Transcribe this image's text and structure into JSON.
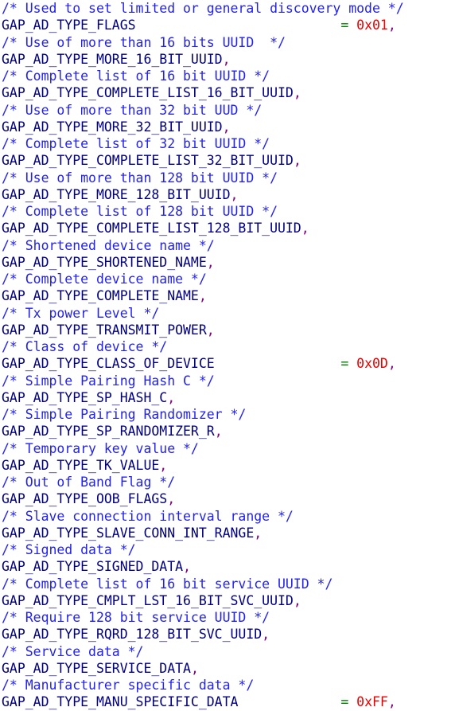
{
  "editor": {
    "background_color": "#ffffff",
    "font_size_px": 16.5,
    "line_height_px": 21.25,
    "language": "c",
    "total_lines": 38
  },
  "syntax_colors": {
    "comment": "#2222ee",
    "identifier": "#000080",
    "operator": "#008000",
    "number": "#ee0000",
    "punctuation": "#800080",
    "plain": "#000000"
  },
  "code": {
    "lines": [
      {
        "tokens": [
          {
            "t": "comment",
            "s": "/* Used to set limited or general discovery mode */"
          }
        ]
      },
      {
        "tokens": [
          {
            "t": "identifier",
            "s": "GAP_AD_TYPE_FLAGS"
          },
          {
            "t": "plain",
            "s": "                          "
          },
          {
            "t": "operator",
            "s": "="
          },
          {
            "t": "plain",
            "s": " "
          },
          {
            "t": "number",
            "s": "0x01"
          },
          {
            "t": "punct",
            "s": ","
          }
        ]
      },
      {
        "tokens": [
          {
            "t": "comment",
            "s": "/* Use of more than 16 bits UUID  */"
          }
        ]
      },
      {
        "tokens": [
          {
            "t": "identifier",
            "s": "GAP_AD_TYPE_MORE_16_BIT_UUID"
          },
          {
            "t": "punct",
            "s": ","
          }
        ]
      },
      {
        "tokens": [
          {
            "t": "comment",
            "s": "/* Complete list of 16 bit UUID */"
          }
        ]
      },
      {
        "tokens": [
          {
            "t": "identifier",
            "s": "GAP_AD_TYPE_COMPLETE_LIST_16_BIT_UUID"
          },
          {
            "t": "punct",
            "s": ","
          }
        ]
      },
      {
        "tokens": [
          {
            "t": "comment",
            "s": "/* Use of more than 32 bit UUD */"
          }
        ]
      },
      {
        "tokens": [
          {
            "t": "identifier",
            "s": "GAP_AD_TYPE_MORE_32_BIT_UUID"
          },
          {
            "t": "punct",
            "s": ","
          }
        ]
      },
      {
        "tokens": [
          {
            "t": "comment",
            "s": "/* Complete list of 32 bit UUID */"
          }
        ]
      },
      {
        "tokens": [
          {
            "t": "identifier",
            "s": "GAP_AD_TYPE_COMPLETE_LIST_32_BIT_UUID"
          },
          {
            "t": "punct",
            "s": ","
          }
        ]
      },
      {
        "tokens": [
          {
            "t": "comment",
            "s": "/* Use of more than 128 bit UUID */"
          }
        ]
      },
      {
        "tokens": [
          {
            "t": "identifier",
            "s": "GAP_AD_TYPE_MORE_128_BIT_UUID"
          },
          {
            "t": "punct",
            "s": ","
          }
        ]
      },
      {
        "tokens": [
          {
            "t": "comment",
            "s": "/* Complete list of 128 bit UUID */"
          }
        ]
      },
      {
        "tokens": [
          {
            "t": "identifier",
            "s": "GAP_AD_TYPE_COMPLETE_LIST_128_BIT_UUID"
          },
          {
            "t": "punct",
            "s": ","
          }
        ]
      },
      {
        "tokens": [
          {
            "t": "comment",
            "s": "/* Shortened device name */"
          }
        ]
      },
      {
        "tokens": [
          {
            "t": "identifier",
            "s": "GAP_AD_TYPE_SHORTENED_NAME"
          },
          {
            "t": "punct",
            "s": ","
          }
        ]
      },
      {
        "tokens": [
          {
            "t": "comment",
            "s": "/* Complete device name */"
          }
        ]
      },
      {
        "tokens": [
          {
            "t": "identifier",
            "s": "GAP_AD_TYPE_COMPLETE_NAME"
          },
          {
            "t": "punct",
            "s": ","
          }
        ]
      },
      {
        "tokens": [
          {
            "t": "comment",
            "s": "/* Tx power Level */"
          }
        ]
      },
      {
        "tokens": [
          {
            "t": "identifier",
            "s": "GAP_AD_TYPE_TRANSMIT_POWER"
          },
          {
            "t": "punct",
            "s": ","
          }
        ]
      },
      {
        "tokens": [
          {
            "t": "comment",
            "s": "/* Class of device */"
          }
        ]
      },
      {
        "tokens": [
          {
            "t": "identifier",
            "s": "GAP_AD_TYPE_CLASS_OF_DEVICE"
          },
          {
            "t": "plain",
            "s": "                "
          },
          {
            "t": "operator",
            "s": "="
          },
          {
            "t": "plain",
            "s": " "
          },
          {
            "t": "number",
            "s": "0x0D"
          },
          {
            "t": "punct",
            "s": ","
          }
        ]
      },
      {
        "tokens": [
          {
            "t": "comment",
            "s": "/* Simple Pairing Hash C */"
          }
        ]
      },
      {
        "tokens": [
          {
            "t": "identifier",
            "s": "GAP_AD_TYPE_SP_HASH_C"
          },
          {
            "t": "punct",
            "s": ","
          }
        ]
      },
      {
        "tokens": [
          {
            "t": "comment",
            "s": "/* Simple Pairing Randomizer */"
          }
        ]
      },
      {
        "tokens": [
          {
            "t": "identifier",
            "s": "GAP_AD_TYPE_SP_RANDOMIZER_R"
          },
          {
            "t": "punct",
            "s": ","
          }
        ]
      },
      {
        "tokens": [
          {
            "t": "comment",
            "s": "/* Temporary key value */"
          }
        ]
      },
      {
        "tokens": [
          {
            "t": "identifier",
            "s": "GAP_AD_TYPE_TK_VALUE"
          },
          {
            "t": "punct",
            "s": ","
          }
        ]
      },
      {
        "tokens": [
          {
            "t": "comment",
            "s": "/* Out of Band Flag */"
          }
        ]
      },
      {
        "tokens": [
          {
            "t": "identifier",
            "s": "GAP_AD_TYPE_OOB_FLAGS"
          },
          {
            "t": "punct",
            "s": ","
          }
        ]
      },
      {
        "tokens": [
          {
            "t": "comment",
            "s": "/* Slave connection interval range */"
          }
        ]
      },
      {
        "tokens": [
          {
            "t": "identifier",
            "s": "GAP_AD_TYPE_SLAVE_CONN_INT_RANGE"
          },
          {
            "t": "punct",
            "s": ","
          }
        ]
      },
      {
        "tokens": [
          {
            "t": "comment",
            "s": "/* Signed data */"
          }
        ]
      },
      {
        "tokens": [
          {
            "t": "identifier",
            "s": "GAP_AD_TYPE_SIGNED_DATA"
          },
          {
            "t": "punct",
            "s": ","
          }
        ]
      },
      {
        "tokens": [
          {
            "t": "comment",
            "s": "/* Complete list of 16 bit service UUID */"
          }
        ]
      },
      {
        "tokens": [
          {
            "t": "identifier",
            "s": "GAP_AD_TYPE_CMPLT_LST_16_BIT_SVC_UUID"
          },
          {
            "t": "punct",
            "s": ","
          }
        ]
      },
      {
        "tokens": [
          {
            "t": "comment",
            "s": "/* Require 128 bit service UUID */"
          }
        ]
      },
      {
        "tokens": [
          {
            "t": "identifier",
            "s": "GAP_AD_TYPE_RQRD_128_BIT_SVC_UUID"
          },
          {
            "t": "punct",
            "s": ","
          }
        ]
      },
      {
        "tokens": [
          {
            "t": "comment",
            "s": "/* Service data */"
          }
        ]
      },
      {
        "tokens": [
          {
            "t": "identifier",
            "s": "GAP_AD_TYPE_SERVICE_DATA"
          },
          {
            "t": "punct",
            "s": ","
          }
        ]
      },
      {
        "tokens": [
          {
            "t": "comment",
            "s": "/* Manufacturer specific data */"
          }
        ]
      },
      {
        "tokens": [
          {
            "t": "identifier",
            "s": "GAP_AD_TYPE_MANU_SPECIFIC_DATA"
          },
          {
            "t": "plain",
            "s": "             "
          },
          {
            "t": "operator",
            "s": "="
          },
          {
            "t": "plain",
            "s": " "
          },
          {
            "t": "number",
            "s": "0xFF"
          },
          {
            "t": "punct",
            "s": ","
          }
        ]
      }
    ]
  }
}
